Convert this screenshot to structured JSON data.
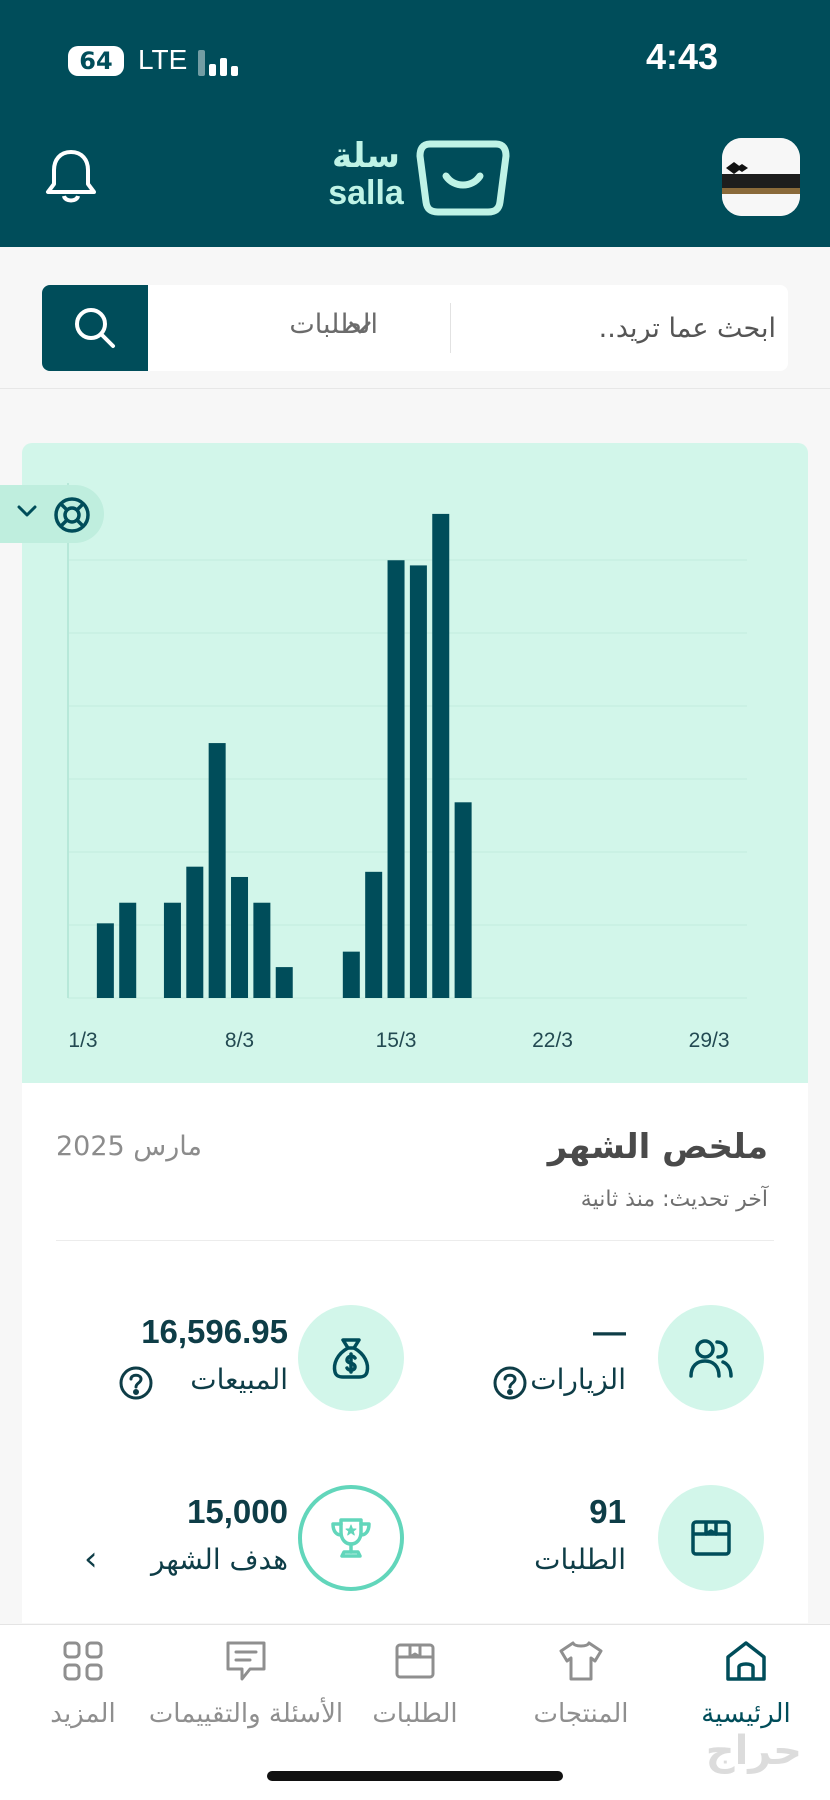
{
  "status_bar": {
    "battery": "64",
    "network": "LTE",
    "time": "4:43"
  },
  "header": {
    "logo_ar": "سلة",
    "logo_en": "salla",
    "notification_icon": "bell-icon",
    "profile_icon": "avatar"
  },
  "search": {
    "placeholder": "ابحث عما تريد..",
    "category": "الطلبات",
    "button_icon": "search-icon"
  },
  "chart_data": {
    "type": "bar",
    "x_tick_labels": [
      "1/3",
      "8/3",
      "15/3",
      "22/3",
      "29/3"
    ],
    "categories": [
      "2/3",
      "3/3",
      "5/3",
      "6/3",
      "7/3",
      "8/3",
      "9/3",
      "10/3",
      "13/3",
      "14/3",
      "15/3",
      "16/3",
      "17/3",
      "18/3"
    ],
    "values": [
      2.9,
      3.7,
      3.7,
      5.1,
      9.9,
      4.7,
      3.7,
      1.2,
      1.8,
      4.9,
      17.0,
      16.8,
      18.8,
      7.6
    ],
    "ylim": [
      0,
      20
    ],
    "grid": true,
    "bar_color": "#004d5a",
    "background": "#d2f6ea"
  },
  "summary": {
    "title": "ملخص الشهر",
    "month": "مارس 2025",
    "updated": "آخر تحديث: منذ ثانية",
    "visits": {
      "value": "—",
      "label": "الزيارات"
    },
    "sales": {
      "value": "16,596.95",
      "label": "المبيعات"
    },
    "orders": {
      "value": "91",
      "label": "الطلبات"
    },
    "goal": {
      "value": "15,000",
      "label": "هدف الشهر",
      "arrow": "‹"
    }
  },
  "nav": {
    "home": "الرئيسية",
    "products": "المنتجات",
    "orders": "الطلبات",
    "reviews": "الأسئلة والتقييمات",
    "more": "المزيد"
  },
  "watermark": "حراج",
  "colors": {
    "primary": "#004d5a",
    "mint": "#d2f6ea",
    "accent": "#62d6bb"
  }
}
